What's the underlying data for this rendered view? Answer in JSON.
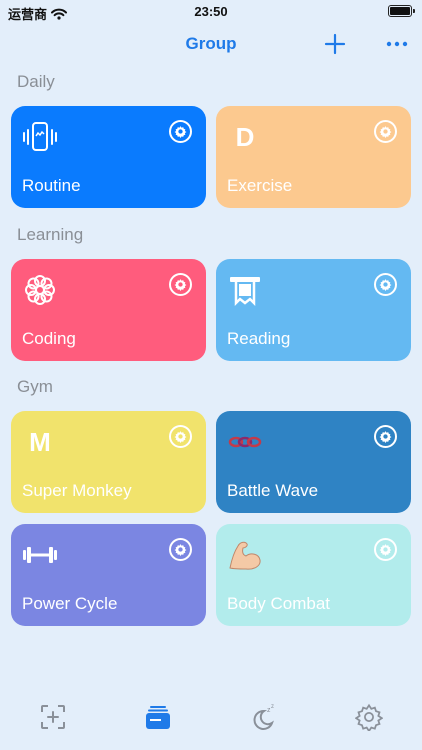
{
  "status_bar": {
    "carrier": "运营商",
    "time": "23:50"
  },
  "nav": {
    "title": "Group",
    "accent_color": "#1f7ae8"
  },
  "sections": [
    {
      "title": "Daily"
    },
    {
      "title": "Learning"
    },
    {
      "title": "Gym"
    }
  ],
  "cards": {
    "routine": {
      "label": "Routine",
      "icon": "phone-vibrate-icon",
      "color": "#0a7bfe"
    },
    "exercise": {
      "label": "Exercise",
      "icon_letter": "D",
      "color": "#fcc98f"
    },
    "coding": {
      "label": "Coding",
      "icon": "flower-icon",
      "color": "#ff5c7d"
    },
    "reading": {
      "label": "Reading",
      "icon": "receipt-icon",
      "color": "#64b9f2"
    },
    "super_monkey": {
      "label": "Super Monkey",
      "icon_letter": "M",
      "color": "#f1e36c"
    },
    "battle_wave": {
      "label": "Battle Wave",
      "icon": "chain-icon",
      "color": "#2f83c4"
    },
    "power_cycle": {
      "label": "Power Cycle",
      "icon": "dumbbell-icon",
      "color": "#7b86e2"
    },
    "body_combat": {
      "label": "Body Combat",
      "icon": "flexed-biceps-icon",
      "color": "#b2ecec"
    }
  },
  "tab_bar": {
    "items": [
      {
        "icon": "add-frame-icon",
        "active": false
      },
      {
        "icon": "cards-icon",
        "active": true
      },
      {
        "icon": "sleep-moon-icon",
        "active": false
      },
      {
        "icon": "settings-gear-icon",
        "active": false
      }
    ]
  }
}
